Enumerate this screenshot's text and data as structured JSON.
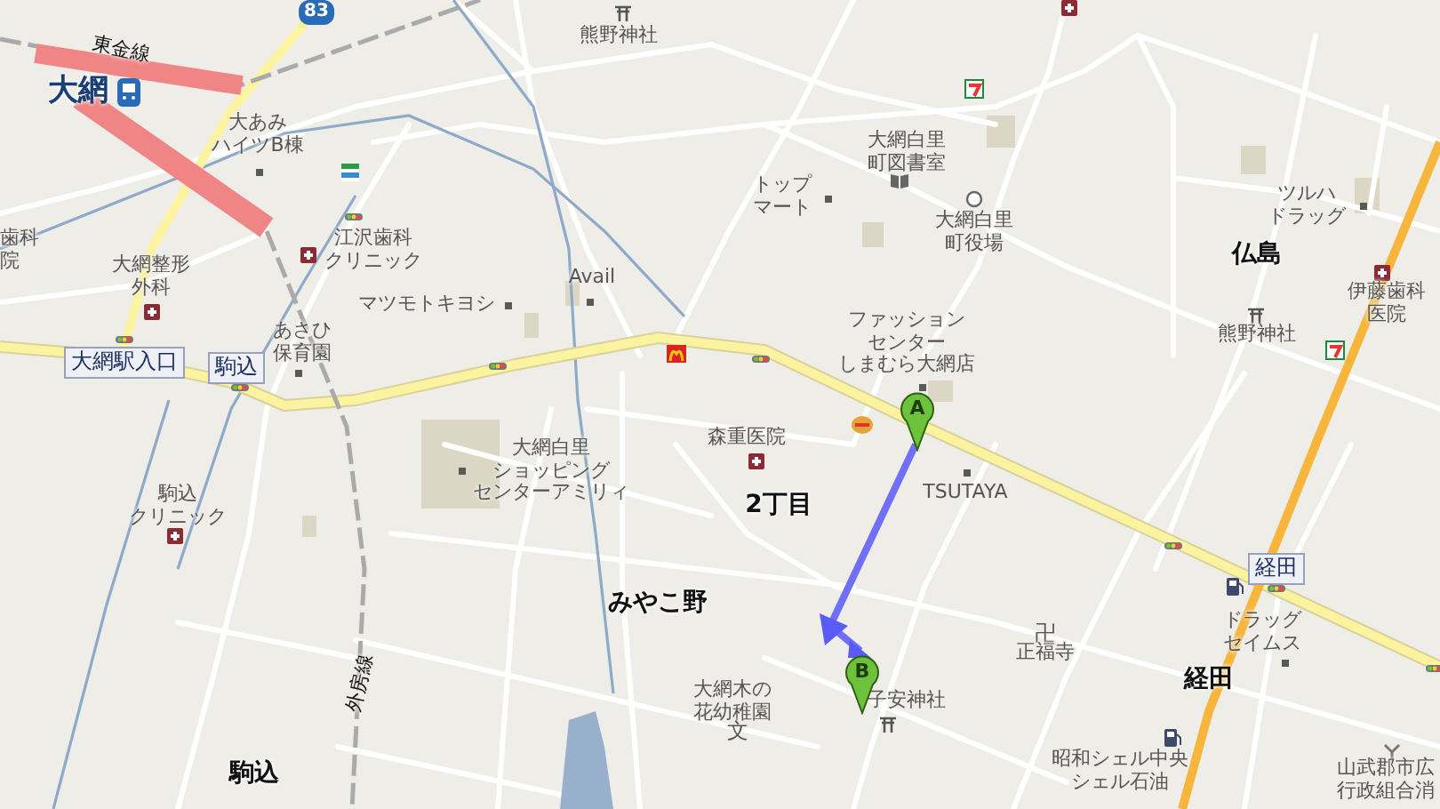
{
  "map": {
    "labels": [
      {
        "kind": "rail",
        "lines": [
          "東金線"
        ]
      },
      {
        "kind": "station",
        "lines": [
          "大網"
        ]
      },
      {
        "kind": "shield",
        "lines": [
          "83"
        ]
      },
      {
        "kind": "place",
        "lines": [
          "熊野神社"
        ]
      },
      {
        "kind": "place",
        "lines": [
          "大あみ",
          "ハイツB棟"
        ]
      },
      {
        "kind": "place",
        "lines": [
          "歯科",
          "院"
        ]
      },
      {
        "kind": "place",
        "lines": [
          "江沢歯科",
          "クリニック"
        ]
      },
      {
        "kind": "place",
        "lines": [
          "大網整形",
          "外科"
        ]
      },
      {
        "kind": "place",
        "lines": [
          "Avail"
        ]
      },
      {
        "kind": "place",
        "lines": [
          "マツモトキヨシ"
        ]
      },
      {
        "kind": "place",
        "lines": [
          "あさひ",
          "保育園"
        ]
      },
      {
        "kind": "boxed",
        "lines": [
          "大網駅入口"
        ]
      },
      {
        "kind": "boxed",
        "lines": [
          "駒込"
        ]
      },
      {
        "kind": "place",
        "lines": [
          "大網白里",
          "町図書室"
        ]
      },
      {
        "kind": "place",
        "lines": [
          "トップ",
          "マート"
        ]
      },
      {
        "kind": "place",
        "lines": [
          "大網白里",
          "町役場"
        ]
      },
      {
        "kind": "place",
        "lines": [
          "ツルハ",
          "ドラッグ"
        ]
      },
      {
        "kind": "district",
        "lines": [
          "仏島"
        ]
      },
      {
        "kind": "place",
        "lines": [
          "伊藤歯科",
          "医院"
        ]
      },
      {
        "kind": "place",
        "lines": [
          "ファッション",
          "センター",
          "しまむら大網店"
        ]
      },
      {
        "kind": "place",
        "lines": [
          "熊野神社"
        ]
      },
      {
        "kind": "place",
        "lines": [
          "駒込",
          "クリニック"
        ]
      },
      {
        "kind": "place",
        "lines": [
          "大網白里",
          "ショッピング",
          "センターアミリィ"
        ]
      },
      {
        "kind": "place",
        "lines": [
          "森重医院"
        ]
      },
      {
        "kind": "district",
        "lines": [
          "2丁目"
        ]
      },
      {
        "kind": "place",
        "lines": [
          "TSUTAYA"
        ]
      },
      {
        "kind": "boxed",
        "lines": [
          "経田"
        ]
      },
      {
        "kind": "district",
        "lines": [
          "みやこ野"
        ]
      },
      {
        "kind": "rail",
        "lines": [
          "外房線"
        ]
      },
      {
        "kind": "symbol",
        "lines": [
          "卍"
        ]
      },
      {
        "kind": "place",
        "lines": [
          "正福寺"
        ]
      },
      {
        "kind": "place",
        "lines": [
          "ドラッグ",
          "セイムス"
        ]
      },
      {
        "kind": "place",
        "lines": [
          "大網木の",
          "花幼稚園"
        ]
      },
      {
        "kind": "place",
        "lines": [
          "子安神社"
        ]
      },
      {
        "kind": "district",
        "lines": [
          "経田"
        ]
      },
      {
        "kind": "symbol",
        "lines": [
          "文"
        ]
      },
      {
        "kind": "district",
        "lines": [
          "駒込"
        ]
      },
      {
        "kind": "place",
        "lines": [
          "昭和シェル中央",
          "シェル石油"
        ]
      },
      {
        "kind": "edge",
        "lines": [
          "山武郡市広",
          "行政組合消"
        ]
      }
    ],
    "markers": [
      {
        "letter": "A"
      },
      {
        "letter": "B"
      }
    ]
  }
}
